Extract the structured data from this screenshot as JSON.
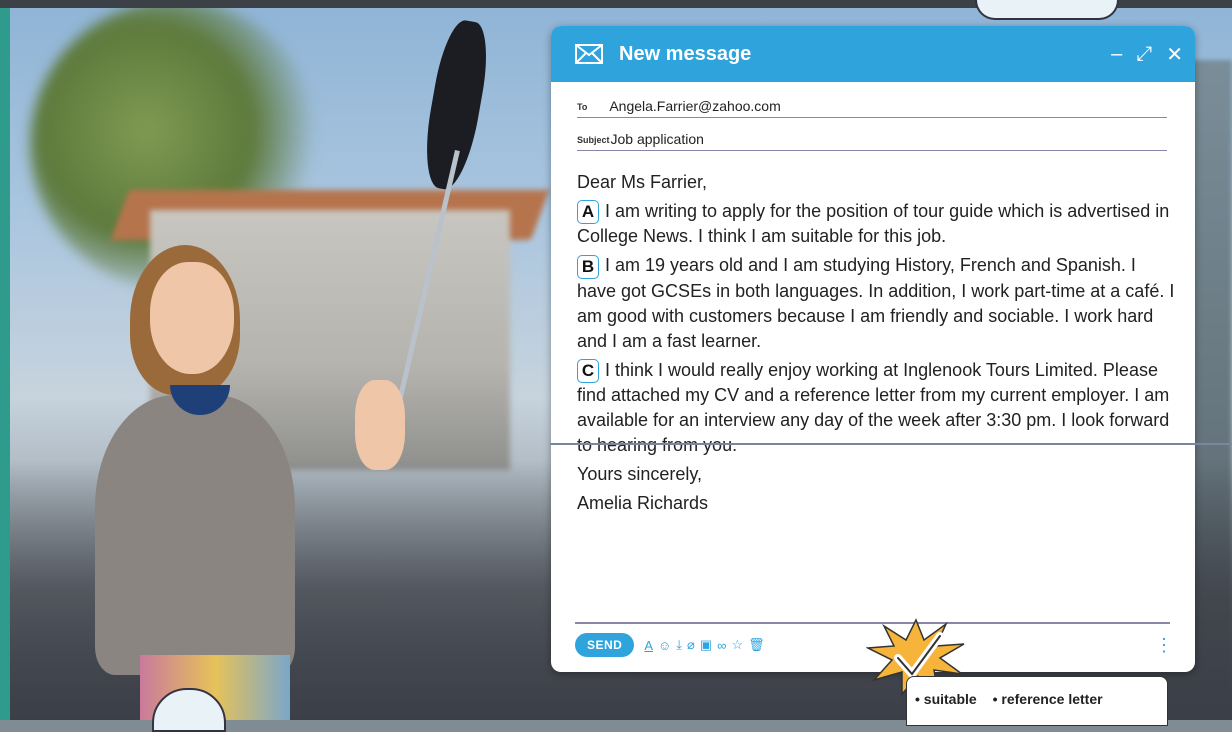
{
  "window": {
    "title": "New message",
    "controls": {
      "minimize": "–",
      "expand": "⤢",
      "close": "✕"
    }
  },
  "fields": {
    "to_label": "To",
    "to_value": "Angela.Farrier@zahoo.com",
    "subject_label": "Subject",
    "subject_value": "Job application"
  },
  "letter": {
    "greeting": "Dear Ms Farrier,",
    "paragraphs": [
      {
        "tag": "A",
        "text": "I am writing to apply for the position of tour guide which is advertised in College News. I think I am suitable for this job."
      },
      {
        "tag": "B",
        "text": "I am 19 years old and I am studying History, French and Spanish. I have got GCSEs in both languages. In addition, I work part-time at a café. I am good with customers because I am friendly and sociable. I work hard and I am a fast learner."
      },
      {
        "tag": "C",
        "text": "I think I would really enjoy working at Inglenook Tours Limited. Please find attached my CV and a reference letter from my current employer. I am available for an interview any day of the week after 3:30 pm. I look forward to hearing from you."
      }
    ],
    "closing": "Yours sincerely,",
    "signature": "Amelia Richards"
  },
  "toolbar": {
    "send_label": "SEND",
    "icons": [
      "text-format",
      "emoji",
      "insert-file",
      "attach",
      "image",
      "link",
      "star",
      "trash"
    ]
  },
  "note": {
    "items": [
      "• suitable",
      "• reference letter"
    ]
  },
  "colors": {
    "accent": "#2ea3dc",
    "border": "#8a86a8"
  }
}
